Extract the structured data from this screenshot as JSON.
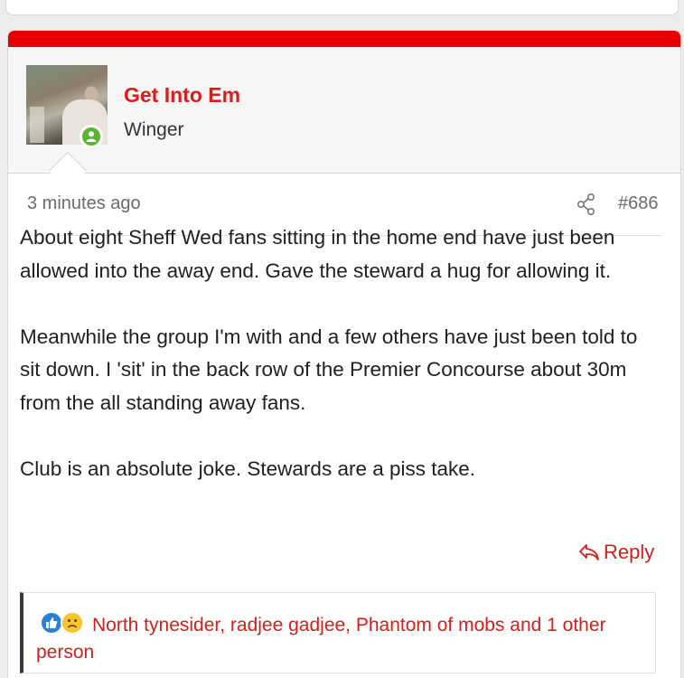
{
  "post": {
    "author": {
      "name": "Get Into Em",
      "title": "Winger",
      "online": true
    },
    "time": "3 minutes ago",
    "number": "#686",
    "body": [
      "About eight Sheff Wed fans sitting in the home end have just been allowed into the away end. Gave the steward a hug for allowing it.",
      "Meanwhile the group I'm with and a few others have just been told to sit down. I 'sit' in the back row of the Premier Concourse about 30m from the all standing away fans.",
      "Club is an absolute joke. Stewards are a piss take."
    ],
    "reply_label": "Reply",
    "reactions": {
      "icons": [
        "like-icon",
        "sad-icon"
      ],
      "text": "North tynesider, radjee gadjee, Phantom of mobs and 1 other",
      "overflow": "person"
    }
  },
  "colors": {
    "accent": "#d91c1c",
    "topbar": "#e60000",
    "online": "#5ab52f",
    "like": "#2b7fd6",
    "sad": "#f7c52b"
  }
}
